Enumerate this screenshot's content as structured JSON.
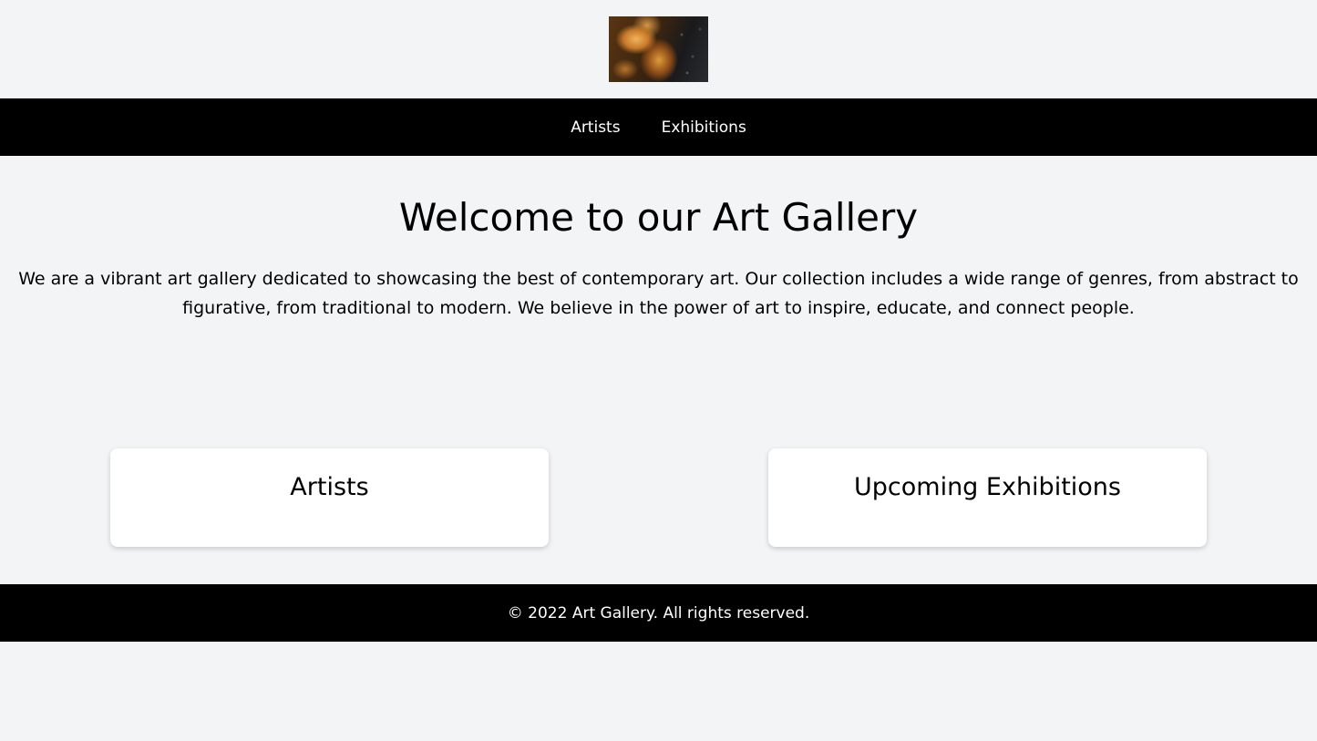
{
  "header": {
    "logo_alt": "Art Gallery logo"
  },
  "nav": {
    "items": [
      {
        "label": "Artists"
      },
      {
        "label": "Exhibitions"
      }
    ]
  },
  "hero": {
    "title": "Welcome to our Art Gallery",
    "description": "We are a vibrant art gallery dedicated to showcasing the best of contemporary art. Our collection includes a wide range of genres, from abstract to figurative, from traditional to modern. We believe in the power of art to inspire, educate, and connect people."
  },
  "cards": [
    {
      "title": "Artists"
    },
    {
      "title": "Upcoming Exhibitions"
    }
  ],
  "footer": {
    "text": "© 2022 Art Gallery. All rights reserved."
  },
  "colors": {
    "background": "#f3f4f6",
    "nav_background": "#000000",
    "card_background": "#ffffff"
  }
}
